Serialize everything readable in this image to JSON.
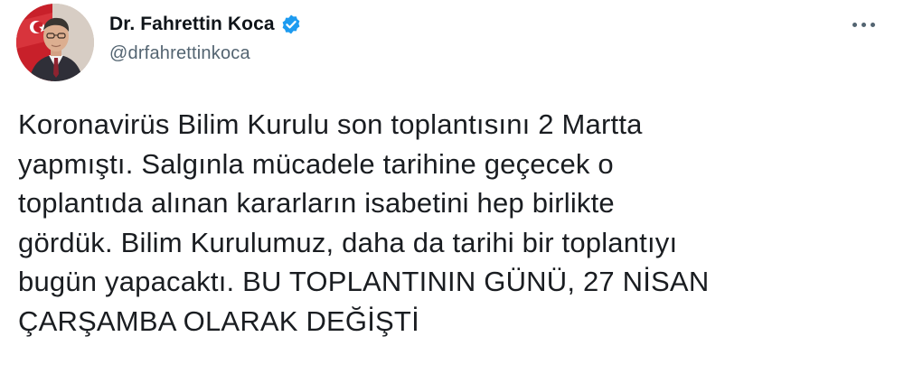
{
  "tweet": {
    "author": {
      "display_name": "Dr. Fahrettin Koca",
      "handle": "@drfahrettinkoca",
      "verified": true
    },
    "text_lines": [
      "Koronavirüs Bilim Kurulu son toplantısını 2 Martta",
      "yapmıştı. Salgınla mücadele tarihine geçecek o",
      "toplantıda alınan kararların isabetini hep birlikte",
      "gördük. Bilim Kurulumuz, daha da tarihi bir toplantıyı",
      "bugün yapacaktı. BU TOPLANTININ GÜNÜ, 27 NİSAN",
      "ÇARŞAMBA OLARAK DEĞİŞTİ"
    ]
  },
  "icons": {
    "verified": "verified-badge-icon",
    "more": "more-options-icon",
    "avatar": "profile-avatar"
  },
  "colors": {
    "verified_blue": "#1d9bf0",
    "handle_gray": "#536471",
    "text": "#0f1419"
  }
}
